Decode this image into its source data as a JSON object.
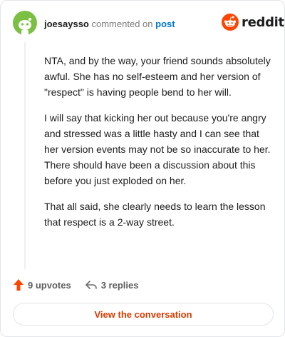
{
  "header": {
    "username": "joesaysso",
    "commented_text": "commented on",
    "post_link_label": "post",
    "logo_text": "reddit",
    "avatar_icon": "snoo-avatar-icon",
    "logo_icon": "reddit-snoo-icon"
  },
  "comment": {
    "paragraphs": [
      "NTA, and by the way, your friend sounds absolutely awful. She has no self-esteem and her version of \"respect\" is having people bend to her will.",
      "I will say that kicking her out because you're angry and stressed was a little hasty and I can see that her version events may not be so inaccurate to her. There should have been a discussion about this before you just exploded on her.",
      "That all said, she clearly needs to learn the lesson that respect is a 2-way street."
    ]
  },
  "actions": {
    "upvotes_label": "9 upvotes",
    "replies_label": "3 replies",
    "upvote_icon": "upvote-arrow-icon",
    "reply_icon": "reply-icon"
  },
  "footer": {
    "view_conversation_label": "View the conversation"
  },
  "colors": {
    "brand_orange": "#ff4500",
    "link_blue": "#0079d3",
    "avatar_green": "#7bc043",
    "button_text": "#d93a00"
  }
}
